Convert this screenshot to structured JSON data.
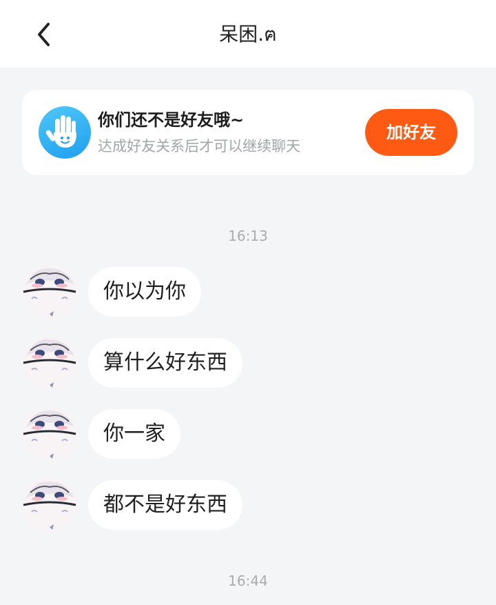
{
  "header": {
    "title": "呆困.ฅ"
  },
  "notice": {
    "title": "你们还不是好友哦~",
    "subtitle": "达成好友关系后才可以继续聊天",
    "add_button": "加好友"
  },
  "timestamps": [
    "16:13",
    "16:44"
  ],
  "messages": [
    {
      "text": "你以为你"
    },
    {
      "text": "算什么好东西"
    },
    {
      "text": "你一家"
    },
    {
      "text": "都不是好东西"
    }
  ],
  "colors": {
    "accent": "#ff5a14",
    "icon": "#1f9ff0",
    "background": "#f4f5f7"
  }
}
